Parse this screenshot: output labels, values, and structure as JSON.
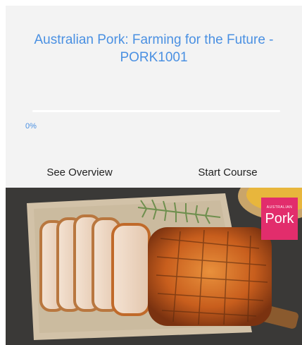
{
  "course": {
    "title": "Australian Pork: Farming for the Future - PORK1001",
    "progress_text": "0%",
    "progress_fraction": 0
  },
  "actions": {
    "overview_label": "See Overview",
    "start_label": "Start Course"
  },
  "image": {
    "logo_small_text": "AUSTRALIAN",
    "logo_big_text": "Pork"
  },
  "colors": {
    "accent": "#4a90e2",
    "card_background": "#f3f3f3",
    "logo_background": "#e22d6c"
  }
}
